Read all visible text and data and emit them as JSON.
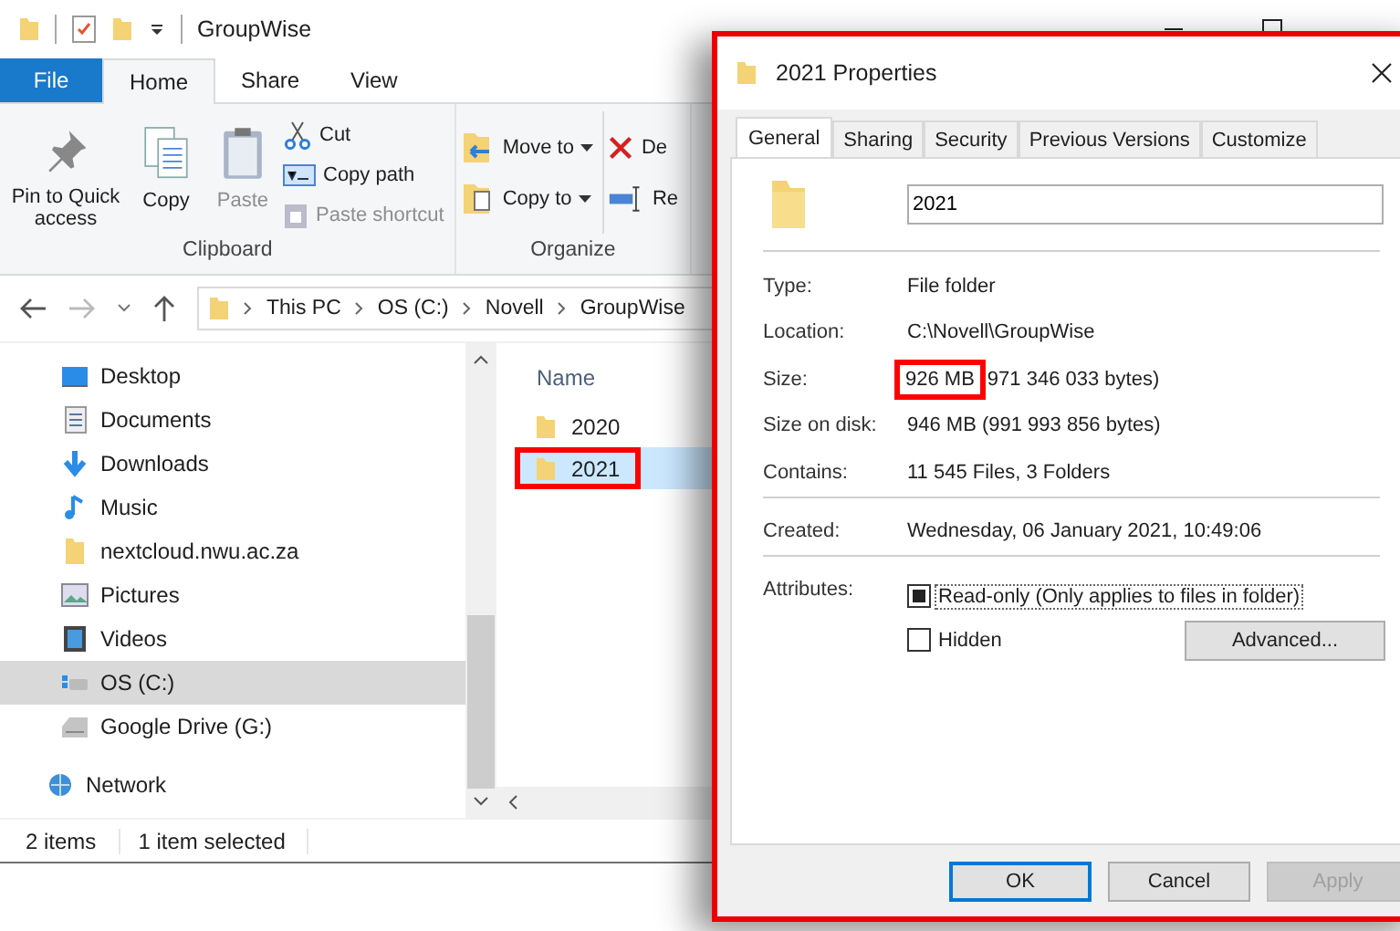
{
  "explorer": {
    "title": "GroupWise",
    "ribbon_tabs": [
      {
        "label": "File",
        "kind": "file",
        "selected": false
      },
      {
        "label": "Home",
        "kind": "tab",
        "selected": true
      },
      {
        "label": "Share",
        "kind": "tab",
        "selected": false
      },
      {
        "label": "View",
        "kind": "tab",
        "selected": false
      }
    ],
    "ribbon_groups": [
      {
        "label": "Clipboard",
        "items": [
          {
            "label": "Pin to Quick access",
            "kind": "large",
            "disabled": false
          },
          {
            "label": "Copy",
            "kind": "large",
            "disabled": false
          },
          {
            "label": "Paste",
            "kind": "large",
            "disabled": true
          },
          {
            "label": "Cut",
            "kind": "small",
            "disabled": false
          },
          {
            "label": "Copy path",
            "kind": "small",
            "disabled": false
          },
          {
            "label": "Paste shortcut",
            "kind": "small",
            "disabled": true
          }
        ]
      },
      {
        "label": "Organize",
        "items": [
          {
            "label": "Move to",
            "kind": "small"
          },
          {
            "label": "Copy to",
            "kind": "small"
          },
          {
            "label": "De",
            "kind": "small"
          },
          {
            "label": "Re",
            "kind": "small"
          }
        ]
      }
    ],
    "breadcrumbs": [
      "This PC",
      "OS (C:)",
      "Novell",
      "GroupWise"
    ],
    "nav_items": [
      {
        "label": "Desktop",
        "selected": false
      },
      {
        "label": "Documents",
        "selected": false
      },
      {
        "label": "Downloads",
        "selected": false
      },
      {
        "label": "Music",
        "selected": false
      },
      {
        "label": "nextcloud.nwu.ac.za",
        "selected": false
      },
      {
        "label": "Pictures",
        "selected": false
      },
      {
        "label": "Videos",
        "selected": false
      },
      {
        "label": "OS (C:)",
        "selected": true
      },
      {
        "label": "Google Drive (G:)",
        "selected": false
      },
      {
        "label": "Network",
        "selected": false
      }
    ],
    "column_header": "Name",
    "files": [
      {
        "name": "2020",
        "selected": false,
        "highlighted": false
      },
      {
        "name": "2021",
        "selected": true,
        "highlighted": true
      }
    ],
    "status_bar": [
      "2 items",
      "1 item selected"
    ]
  },
  "dialog": {
    "title": "2021 Properties",
    "tabs": [
      {
        "label": "General",
        "selected": true
      },
      {
        "label": "Sharing",
        "selected": false
      },
      {
        "label": "Security",
        "selected": false
      },
      {
        "label": "Previous Versions",
        "selected": false
      },
      {
        "label": "Customize",
        "selected": false
      }
    ],
    "name_value": "2021",
    "groups": [
      [
        {
          "label": "Type:",
          "value": "File folder"
        },
        {
          "label": "Location:",
          "value": "C:\\Novell\\GroupWise"
        },
        {
          "label": "Size:",
          "highlight": "926 MB",
          "value": "971 346 033 bytes)"
        },
        {
          "label": "Size on disk:",
          "value": "946 MB (991 993 856 bytes)"
        },
        {
          "label": "Contains:",
          "value": "11 545 Files, 3 Folders"
        }
      ],
      [
        {
          "label": "Created:",
          "value": "Wednesday, 06 January 2021, 10:49:06"
        }
      ]
    ],
    "attributes_label": "Attributes:",
    "attributes": [
      {
        "label": "Read-only (Only applies to files in folder)",
        "checked": true,
        "indeterminate": true,
        "focused": true
      },
      {
        "label": "Hidden",
        "checked": false,
        "indeterminate": false,
        "focused": false
      }
    ],
    "advanced_button": "Advanced...",
    "buttons": [
      {
        "label": "OK",
        "default": true,
        "disabled": false
      },
      {
        "label": "Cancel",
        "default": false,
        "disabled": false
      },
      {
        "label": "Apply",
        "default": false,
        "disabled": true
      }
    ]
  }
}
